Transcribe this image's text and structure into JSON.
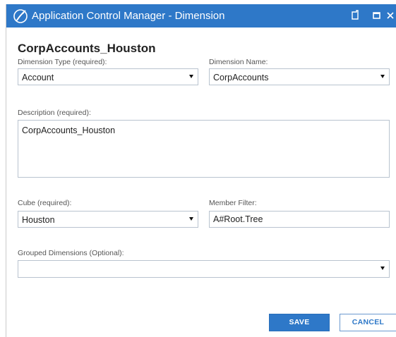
{
  "window": {
    "title": "Application Control Manager - Dimension",
    "icons": {
      "app": "onestream-logo-icon",
      "restore": "restore-icon",
      "maximize": "maximize-icon",
      "close": "close-icon"
    }
  },
  "page_title": "CorpAccounts_Houston",
  "fields": {
    "dimension_type": {
      "label": "Dimension Type (required):",
      "value": "Account"
    },
    "dimension_name": {
      "label": "Dimension Name:",
      "value": "CorpAccounts"
    },
    "description": {
      "label": "Description (required):",
      "value": "CorpAccounts_Houston"
    },
    "cube": {
      "label": "Cube (required):",
      "value": "Houston"
    },
    "member_filter": {
      "label": "Member Filter:",
      "value": "A#Root.Tree"
    },
    "grouped_dimensions": {
      "label": "Grouped Dimensions (Optional):",
      "value": ""
    }
  },
  "buttons": {
    "save": "SAVE",
    "cancel": "CANCEL"
  },
  "colors": {
    "accent": "#2e78c8",
    "field_border": "#b9c3cf",
    "label": "#555555"
  }
}
